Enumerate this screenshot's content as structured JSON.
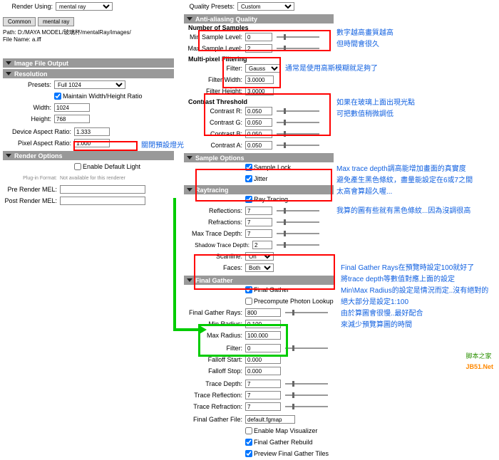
{
  "top": {
    "renderUsing": "Render Using:",
    "renderer": "mental ray"
  },
  "tabs": {
    "common": "Common",
    "mentalray": "mental ray"
  },
  "paths": {
    "path": "Path: D:/MAYA MODEL/玻璃杯/mentalRay/images/",
    "fileName": "File Name:  a.iff"
  },
  "sections": {
    "imageFileOutput": "Image File Output",
    "resolution": "Resolution",
    "renderOptions": "Render Options",
    "antiAliasing": "Anti-aliasing Quality",
    "sampleOptions": "Sample Options",
    "raytracing": "Raytracing",
    "finalGather": "Final Gather"
  },
  "resolution": {
    "presets": "Presets:",
    "presetsVal": "Full 1024",
    "maintain": "Maintain Width/Height Ratio",
    "width": "Width:",
    "widthVal": "1024",
    "height": "Height:",
    "heightVal": "768",
    "dar": "Device Aspect Ratio:",
    "darVal": "1.333",
    "par": "Pixel Aspect Ratio:",
    "parVal": "1.000"
  },
  "renderOptions": {
    "enableDefault": "Enable Default Light",
    "plugin": "Plug-in Format:",
    "pluginVal": "Not available for this renderer",
    "pre": "Pre Render MEL:",
    "post": "Post Render MEL:"
  },
  "quality": {
    "presets": "Quality Presets:",
    "presetsVal": "Custom"
  },
  "samples": {
    "header": "Number of Samples",
    "min": "Min Sample Level:",
    "minVal": "0",
    "max": "Max Sample Level:",
    "maxVal": "2"
  },
  "filtering": {
    "header": "Multi-pixel Filtering",
    "filter": "Filter:",
    "filterVal": "Gauss",
    "width": "Filter Width:",
    "widthVal": "3.0000",
    "height": "Filter Height:",
    "heightVal": "3.0000"
  },
  "contrast": {
    "header": "Contrast Threshold",
    "r": "Contrast R:",
    "g": "Contrast G:",
    "b": "Contrast B:",
    "a": "Contrast A:",
    "val": "0.050"
  },
  "sampleOpts": {
    "lock": "Sample Lock",
    "jitter": "Jitter"
  },
  "raytrace": {
    "ray": "Ray Tracing",
    "refl": "Reflections:",
    "reflVal": "7",
    "refr": "Refractions:",
    "refrVal": "7",
    "max": "Max Trace Depth:",
    "maxVal": "7",
    "shadow": "Shadow Trace Depth:",
    "shadowVal": "2",
    "scan": "Scanline:",
    "scanVal": "On",
    "faces": "Faces:",
    "facesVal": "Both"
  },
  "fg": {
    "fg": "Final Gather",
    "precompute": "Precompute Photon Lookup",
    "rays": "Final Gather Rays:",
    "raysVal": "800",
    "minR": "Min Radius:",
    "minRVal": "0.100",
    "maxR": "Max Radius:",
    "maxRVal": "100.000",
    "filter": "Filter:",
    "filterVal": "0",
    "fstart": "Falloff Start:",
    "fstartVal": "0.000",
    "fstop": "Falloff Stop:",
    "fstopVal": "0.000",
    "tdepth": "Trace Depth:",
    "tdepthVal": "7",
    "trefl": "Trace Reflection:",
    "treflVal": "7",
    "trefr": "Trace Refraction:",
    "trefrVal": "7",
    "file": "Final Gather File:",
    "fileVal": "default.fgmap",
    "enableMap": "Enable Map Visualizer",
    "rebuild": "Final Gather Rebuild",
    "preview": "Preview Final Gather Tiles"
  },
  "annotations": {
    "a1": "關閉預設燈光",
    "b1": "數字越高畫質越高",
    "b2": "但時間會很久",
    "c1": "通常是使用高斯模糊就足夠了",
    "d1": "如果在玻璃上面出現光點",
    "d2": "可把數值稍微調低",
    "e1": "Max trace depth調高能增加畫面的真實度",
    "e2": "避免產生黑色條紋，盡量能設定在6或7之間",
    "e3": "太高會算超久喔...",
    "e4": "我算的圖有些就有黑色條紋...因為沒調很高",
    "f1": "Final Gather Rays在預覽時設定100就好了",
    "f2": "將trace depth等數值對應上面的設定",
    "f3": "Min\\Max Radius的設定是情況而定..沒有絕對的",
    "f4": "絕大部分是設定1:100",
    "f5": "由於算圖會很慢..最好配合",
    "f6": "來減少預覽算圖的時間"
  },
  "logo": {
    "cn": "脚本之家",
    "en": "JB51.Net"
  }
}
